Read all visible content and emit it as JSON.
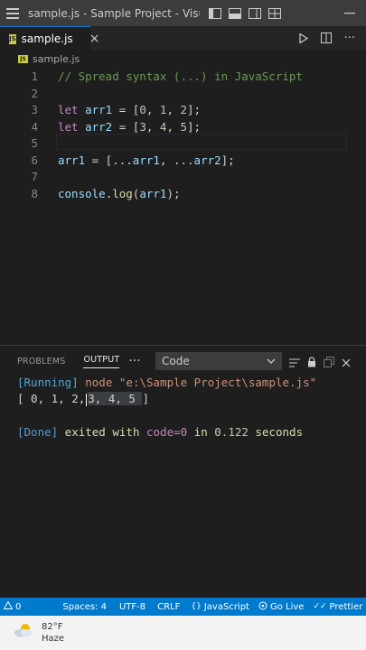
{
  "window": {
    "title": "sample.js - Sample Project - Visual Studi..."
  },
  "tabs": [
    {
      "label": "sample.js",
      "icon": "js-file-icon",
      "close": "×"
    }
  ],
  "breadcrumb": {
    "file": "sample.js"
  },
  "editor": {
    "line_numbers": [
      "1",
      "2",
      "3",
      "4",
      "5",
      "6",
      "7",
      "8"
    ],
    "lines": [
      [
        {
          "t": "// Spread syntax (...) in JavaScript",
          "c": "cmt"
        }
      ],
      [],
      [
        {
          "t": "let",
          "c": "kw"
        },
        {
          "t": " arr1 ",
          "c": "var"
        },
        {
          "t": "= [",
          "c": "op"
        },
        {
          "t": "0",
          "c": "num"
        },
        {
          "t": ", ",
          "c": "op"
        },
        {
          "t": "1",
          "c": "num"
        },
        {
          "t": ", ",
          "c": "op"
        },
        {
          "t": "2",
          "c": "num"
        },
        {
          "t": "];",
          "c": "op"
        }
      ],
      [
        {
          "t": "let",
          "c": "kw"
        },
        {
          "t": " arr2 ",
          "c": "var"
        },
        {
          "t": "= [",
          "c": "op"
        },
        {
          "t": "3",
          "c": "num"
        },
        {
          "t": ", ",
          "c": "op"
        },
        {
          "t": "4",
          "c": "num"
        },
        {
          "t": ", ",
          "c": "op"
        },
        {
          "t": "5",
          "c": "num"
        },
        {
          "t": "];",
          "c": "op"
        }
      ],
      [],
      [
        {
          "t": "arr1",
          "c": "var"
        },
        {
          "t": " = [",
          "c": "op"
        },
        {
          "t": "...",
          "c": "op"
        },
        {
          "t": "arr1",
          "c": "var"
        },
        {
          "t": ", ",
          "c": "op"
        },
        {
          "t": "...",
          "c": "op"
        },
        {
          "t": "arr2",
          "c": "var"
        },
        {
          "t": "];",
          "c": "op"
        }
      ],
      [],
      [
        {
          "t": "console",
          "c": "var"
        },
        {
          "t": ".",
          "c": "op"
        },
        {
          "t": "log",
          "c": "fn"
        },
        {
          "t": "(",
          "c": "op"
        },
        {
          "t": "arr1",
          "c": "var"
        },
        {
          "t": ");",
          "c": "op"
        }
      ]
    ]
  },
  "panel": {
    "tabs": {
      "problems": "PROBLEMS",
      "output": "OUTPUT",
      "more": "···"
    },
    "channel": "Code",
    "output": {
      "running_tag": "[Running]",
      "running_cmd": " node \"e:\\Sample Project\\sample.js\"",
      "result_pre": "[ 0, 1, 2,",
      "result_sel": "3, 4, 5 ",
      "result_post": "]",
      "done_tag": "[Done]",
      "done_text": " exited with ",
      "done_code": "code=0",
      "done_in": " in ",
      "done_secs": "0.122",
      "done_unit": " seconds"
    }
  },
  "statusbar": {
    "errors": "0",
    "warnings": "0",
    "spaces": "Spaces: 4",
    "encoding": "UTF-8",
    "eol": "CRLF",
    "language": "JavaScript",
    "golive": "Go Live",
    "prettier": "Prettier"
  },
  "taskbar": {
    "temperature": "82°F",
    "condition": "Haze"
  },
  "colors": {
    "accent": "#007acc",
    "js_badge": "#cbcb41"
  }
}
